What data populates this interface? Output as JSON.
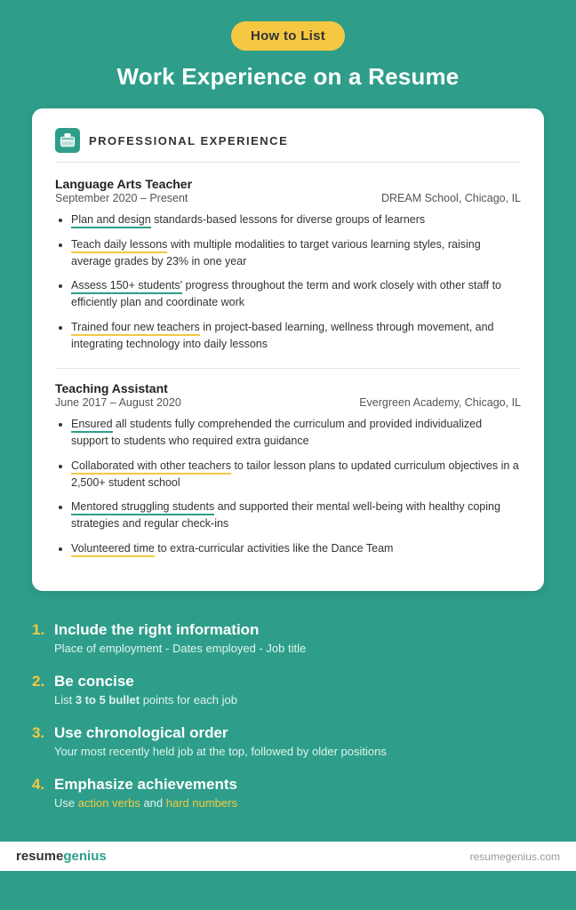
{
  "badge": {
    "label": "How to List"
  },
  "main_title": "Work Experience on a Resume",
  "card": {
    "section_title": "PROFESSIONAL EXPERIENCE",
    "jobs": [
      {
        "title": "Language Arts Teacher",
        "dates": "September 2020 – Present",
        "company": "DREAM School, Chicago, IL",
        "bullets": [
          {
            "underline_text": "Plan and design",
            "underline_type": "green",
            "rest": " standards-based lessons for diverse groups of learners"
          },
          {
            "underline_text": "Teach daily lessons",
            "underline_type": "yellow",
            "rest": " with multiple modalities to target various learning styles, raising average grades by 23% in one year"
          },
          {
            "underline_text": "Assess 150+ students'",
            "underline_type": "green",
            "rest": " progress throughout the term and work closely with other staff to efficiently plan and coordinate work"
          },
          {
            "underline_text": "Trained four new teachers",
            "underline_type": "yellow",
            "rest": " in project-based learning, wellness through movement, and integrating technology into daily lessons"
          }
        ]
      },
      {
        "title": "Teaching Assistant",
        "dates": "June 2017 – August 2020",
        "company": "Evergreen Academy, Chicago, IL",
        "bullets": [
          {
            "underline_text": "Ensured",
            "underline_type": "green",
            "rest": " all students fully comprehended the curriculum and provided individualized support to students who required extra guidance"
          },
          {
            "underline_text": "Collaborated with other teachers",
            "underline_type": "yellow",
            "rest": " to tailor lesson plans to updated curriculum objectives in a 2,500+ student school"
          },
          {
            "underline_text": "Mentored struggling students",
            "underline_type": "green",
            "rest": " and supported their mental well-being with healthy coping strategies and regular check-ins"
          },
          {
            "underline_text": "Volunteered time",
            "underline_type": "yellow",
            "rest": " to extra-curricular activities like the Dance Team"
          }
        ]
      }
    ]
  },
  "tips": [
    {
      "number": "1.",
      "heading": "Include the right information",
      "desc": "Place of employment - Dates employed - Job title",
      "has_colored": false
    },
    {
      "number": "2.",
      "heading": "Be concise",
      "desc_parts": [
        "List ",
        "3 to 5 bullet",
        " points for each job"
      ],
      "bold_part": "3 to 5 bullet",
      "has_colored": false
    },
    {
      "number": "3.",
      "heading": "Use chronological order",
      "desc": "Your most recently held job at the top, followed by older positions",
      "has_colored": false
    },
    {
      "number": "4.",
      "heading": "Emphasize achievements",
      "desc_before": "Use ",
      "action_verbs_text": "action verbs",
      "desc_middle": " and ",
      "hard_numbers_text": "hard numbers",
      "has_colored": true
    }
  ],
  "footer": {
    "logo_resume": "resume",
    "logo_genius": "genius",
    "url": "resumegenius.com"
  }
}
